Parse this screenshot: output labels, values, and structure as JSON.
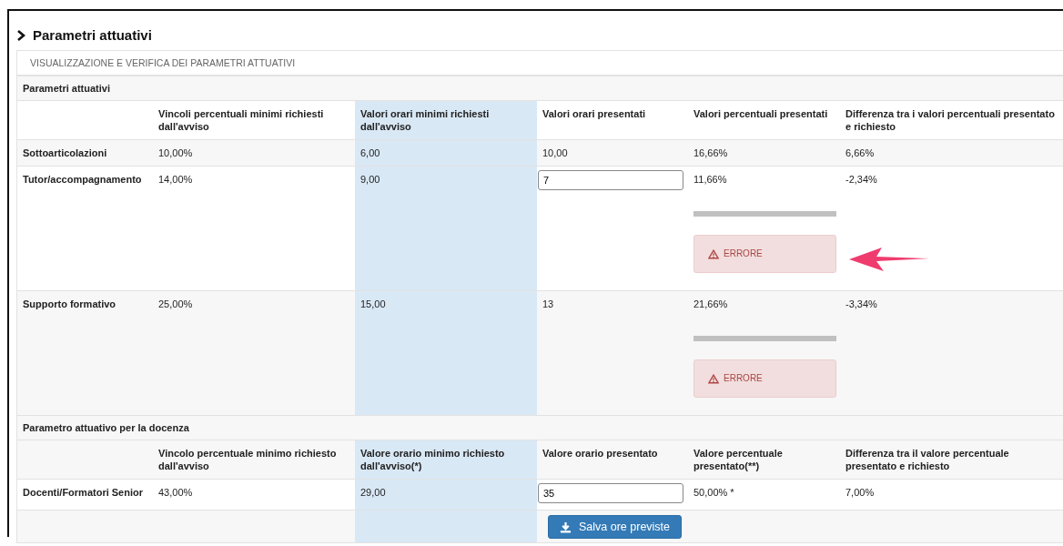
{
  "section": {
    "title": "Parametri attuativi"
  },
  "panel": {
    "heading": "VISUALIZZAZIONE E VERIFICA DEI PARAMETRI ATTUATIVI"
  },
  "groups": [
    {
      "title": "Parametri attuativi",
      "columns": [
        {
          "heading": "Vincoli percentuali minimi richiesti dall'avviso",
          "highlighted": false
        },
        {
          "heading": "Valori orari minimi richiesti dall'avviso",
          "highlighted": true
        },
        {
          "heading": "Valori orari presentati",
          "highlighted": false
        },
        {
          "heading": "Valori percentuali presentati",
          "highlighted": false
        },
        {
          "heading": "Differenza tra i valori percentuali presentato e richiesto",
          "highlighted": false
        }
      ],
      "rows": [
        {
          "label": "Sottoarticolazioni",
          "cells": [
            {
              "kind": "text",
              "text": "10,00%"
            },
            {
              "kind": "text",
              "text": "6,00"
            },
            {
              "kind": "text",
              "text": "10,00"
            },
            {
              "kind": "text",
              "text": "16,66%"
            },
            {
              "kind": "text",
              "text": "6,66%"
            }
          ]
        },
        {
          "label": "Tutor/accompagnamento",
          "cells": [
            {
              "kind": "text",
              "text": "14,00%"
            },
            {
              "kind": "text",
              "text": "9,00"
            },
            {
              "kind": "input",
              "value": "7"
            },
            {
              "kind": "text",
              "text": "11,66%",
              "progress": {
                "level": 1
              },
              "alert": "ERRORE"
            },
            {
              "kind": "text",
              "text": "-2,34%"
            }
          ]
        },
        {
          "label": "Supporto formativo",
          "cells": [
            {
              "kind": "text",
              "text": "25,00%"
            },
            {
              "kind": "text",
              "text": "15,00"
            },
            {
              "kind": "text",
              "text": "13"
            },
            {
              "kind": "text",
              "text": "21,66%",
              "progress": {
                "level": 1
              },
              "alert": "ERRORE"
            },
            {
              "kind": "text",
              "text": "-3,34%"
            }
          ]
        }
      ]
    },
    {
      "title": "Parametro attuativo per la docenza",
      "columns": [
        {
          "heading": "Vincolo percentuale minimo richiesto dall'avviso",
          "highlighted": false
        },
        {
          "heading": "Valore orario minimo richiesto dall'avviso(*)",
          "highlighted": true
        },
        {
          "heading": "Valore orario presentato",
          "highlighted": false
        },
        {
          "heading": "Valore percentuale presentato(**)",
          "highlighted": false
        },
        {
          "heading": "Differenza tra il valore percentuale presentato e richiesto",
          "highlighted": false
        }
      ],
      "rows": [
        {
          "label": "Docenti/Formatori Senior",
          "cells": [
            {
              "kind": "text",
              "text": "43,00%"
            },
            {
              "kind": "text",
              "text": "29,00"
            },
            {
              "kind": "input",
              "value": "35"
            },
            {
              "kind": "text",
              "text": "50,00% *"
            },
            {
              "kind": "text",
              "text": "7,00%"
            }
          ]
        }
      ],
      "button": {
        "label": "Salva ore previste"
      }
    }
  ]
}
